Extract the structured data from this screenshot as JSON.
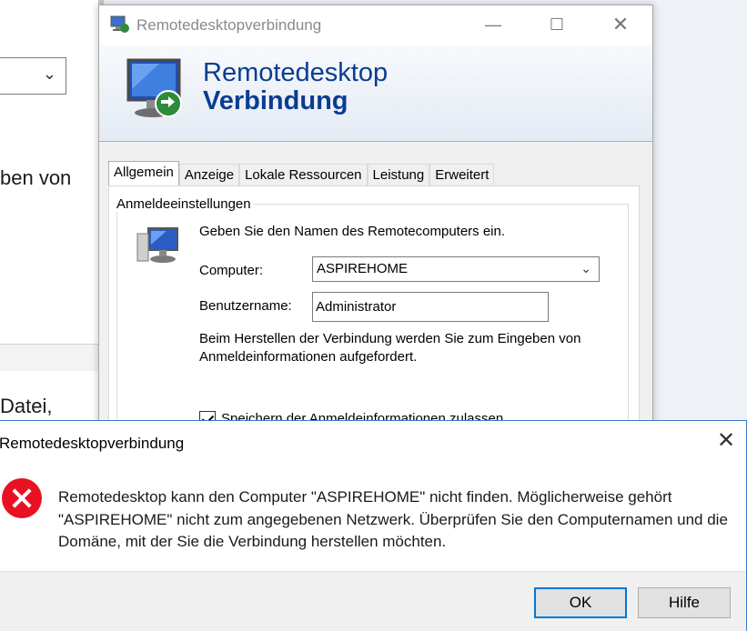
{
  "background_window": {
    "partial_text_1": "ben von",
    "partial_text_2": "Datei,"
  },
  "rdp_window": {
    "title": "Remotedesktopverbindung",
    "banner_line1": "Remotedesktop",
    "banner_line2": "Verbindung",
    "tabs": [
      {
        "label": "Allgemein",
        "active": true
      },
      {
        "label": "Anzeige",
        "active": false
      },
      {
        "label": "Lokale Ressourcen",
        "active": false
      },
      {
        "label": "Leistung",
        "active": false
      },
      {
        "label": "Erweitert",
        "active": false
      }
    ],
    "group_label": "Anmeldeeinstellungen",
    "hint": "Geben Sie den Namen des Remotecomputers ein.",
    "computer_label": "Computer:",
    "computer_value": "ASPIREHOME",
    "username_label": "Benutzername:",
    "username_value": "Administrator",
    "info_text": "Beim Herstellen der Verbindung werden Sie zum Eingeben von Anmeldeinformationen aufgefordert.",
    "save_credentials_label": "Speichern der Anmeldeinformationen zulassen",
    "save_credentials_checked": true
  },
  "error_dialog": {
    "title": "Remotedesktopverbindung",
    "message": "Remotedesktop kann den Computer \"ASPIREHOME\" nicht finden. Möglicherweise gehört \"ASPIREHOME\" nicht zum angegebenen Netzwerk. Überprüfen Sie den Computernamen und die Domäne, mit der Sie die Verbindung herstellen möchten.",
    "ok_label": "OK",
    "help_label": "Hilfe",
    "icon": "error-icon",
    "icon_color": "#e81123"
  },
  "colors": {
    "banner_text": "#0a3d91",
    "focus_border": "#0078d7"
  }
}
